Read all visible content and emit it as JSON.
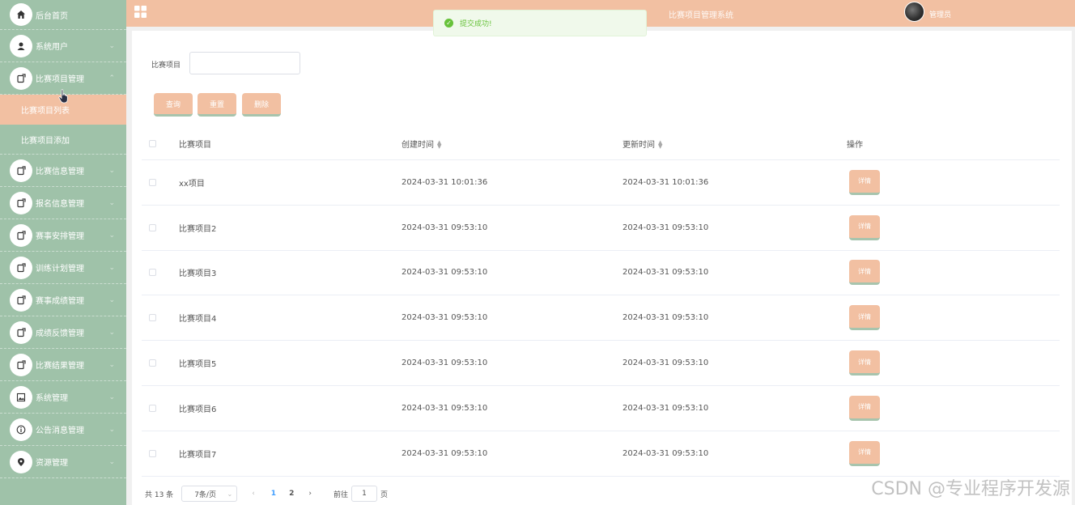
{
  "header": {
    "system_title": "比赛项目管理系统",
    "admin_name": "管理员"
  },
  "toast": {
    "message": "提交成功!"
  },
  "sidebar": {
    "items": [
      {
        "label": "后台首页",
        "icon": "home-icon"
      },
      {
        "label": "系统用户",
        "icon": "user-icon"
      },
      {
        "label": "比赛项目管理",
        "icon": "doc-icon",
        "expanded": true,
        "children": [
          {
            "label": "比赛项目列表",
            "active": true
          },
          {
            "label": "比赛项目添加",
            "active": false
          }
        ]
      },
      {
        "label": "比赛信息管理",
        "icon": "doc-icon"
      },
      {
        "label": "报名信息管理",
        "icon": "doc-icon"
      },
      {
        "label": "赛事安排管理",
        "icon": "doc-icon"
      },
      {
        "label": "训练计划管理",
        "icon": "doc-icon"
      },
      {
        "label": "赛事成绩管理",
        "icon": "doc-icon"
      },
      {
        "label": "成绩反馈管理",
        "icon": "doc-icon"
      },
      {
        "label": "比赛结果管理",
        "icon": "doc-icon"
      },
      {
        "label": "系统管理",
        "icon": "picture-icon"
      },
      {
        "label": "公告消息管理",
        "icon": "info-icon"
      },
      {
        "label": "资源管理",
        "icon": "location-icon"
      }
    ]
  },
  "search": {
    "label": "比赛项目",
    "value": ""
  },
  "buttons": {
    "query": "查询",
    "reset": "重置",
    "delete": "删除"
  },
  "table": {
    "headers": {
      "name": "比赛项目",
      "created": "创建时间",
      "updated": "更新时间",
      "action": "操作"
    },
    "rows": [
      {
        "name": "xx项目",
        "created": "2024-03-31 10:01:36",
        "updated": "2024-03-31 10:01:36",
        "action": "详情"
      },
      {
        "name": "比赛项目2",
        "created": "2024-03-31 09:53:10",
        "updated": "2024-03-31 09:53:10",
        "action": "详情"
      },
      {
        "name": "比赛项目3",
        "created": "2024-03-31 09:53:10",
        "updated": "2024-03-31 09:53:10",
        "action": "详情"
      },
      {
        "name": "比赛项目4",
        "created": "2024-03-31 09:53:10",
        "updated": "2024-03-31 09:53:10",
        "action": "详情"
      },
      {
        "name": "比赛项目5",
        "created": "2024-03-31 09:53:10",
        "updated": "2024-03-31 09:53:10",
        "action": "详情"
      },
      {
        "name": "比赛项目6",
        "created": "2024-03-31 09:53:10",
        "updated": "2024-03-31 09:53:10",
        "action": "详情"
      },
      {
        "name": "比赛项目7",
        "created": "2024-03-31 09:53:10",
        "updated": "2024-03-31 09:53:10",
        "action": "详情"
      }
    ]
  },
  "pagination": {
    "total": "共 13 条",
    "page_size": "7条/页",
    "pages": [
      "1",
      "2"
    ],
    "current": "1",
    "goto_label": "前往",
    "goto_value": "1",
    "page_suffix": "页"
  },
  "watermark": "CSDN @专业程序开发源",
  "colors": {
    "sidebar": "#9fc2a9",
    "accent": "#f2c0a2",
    "success": "#67c23a",
    "link": "#409eff"
  }
}
